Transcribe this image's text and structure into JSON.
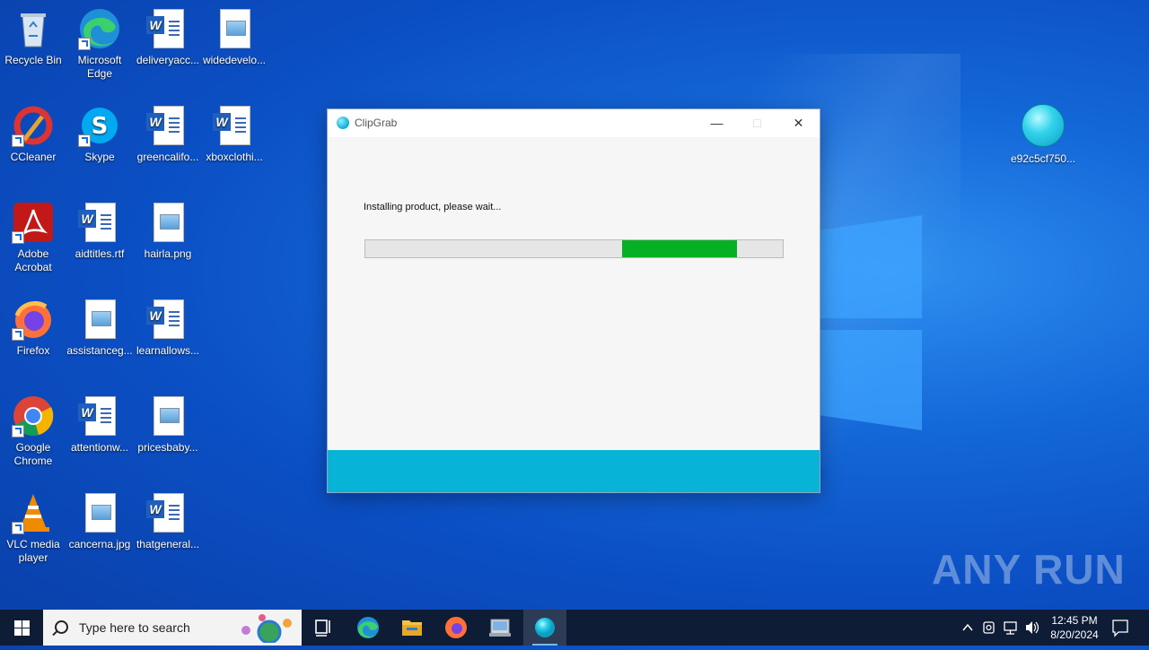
{
  "desktop": {
    "icons_left": [
      {
        "label": "Recycle Bin"
      },
      {
        "label": "Microsoft Edge"
      },
      {
        "label": "deliveryacc..."
      },
      {
        "label": "widedevelo..."
      },
      {
        "label": "CCleaner"
      },
      {
        "label": "Skype"
      },
      {
        "label": "greencalifo..."
      },
      {
        "label": "xboxclothi..."
      },
      {
        "label": "Adobe Acrobat"
      },
      {
        "label": "aidtitles.rtf"
      },
      {
        "label": "hairla.png"
      },
      {
        "label": "Firefox"
      },
      {
        "label": "assistanceg..."
      },
      {
        "label": "learnallows..."
      },
      {
        "label": "Google Chrome"
      },
      {
        "label": "attentionw..."
      },
      {
        "label": "pricesbaby..."
      },
      {
        "label": "VLC media player"
      },
      {
        "label": "cancerna.jpg"
      },
      {
        "label": "thatgeneral..."
      }
    ],
    "icon_right": {
      "label": "e92c5cf750..."
    },
    "watermark": "ANY RUN"
  },
  "dialog": {
    "title": "ClipGrab",
    "status_text": "Installing product, please wait...",
    "progress": {
      "start_fraction": 0.615,
      "end_fraction": 0.89
    },
    "footer_color": "#07b4d8"
  },
  "taskbar": {
    "search_placeholder": "Type here to search",
    "apps": [
      "task-view",
      "edge",
      "file-explorer",
      "firefox",
      "installer",
      "clipgrab"
    ],
    "clock_time": "12:45 PM",
    "clock_date": "8/20/2024"
  },
  "colors": {
    "progress_fill": "#06b025",
    "taskbar_bg": "#0f1c35"
  }
}
